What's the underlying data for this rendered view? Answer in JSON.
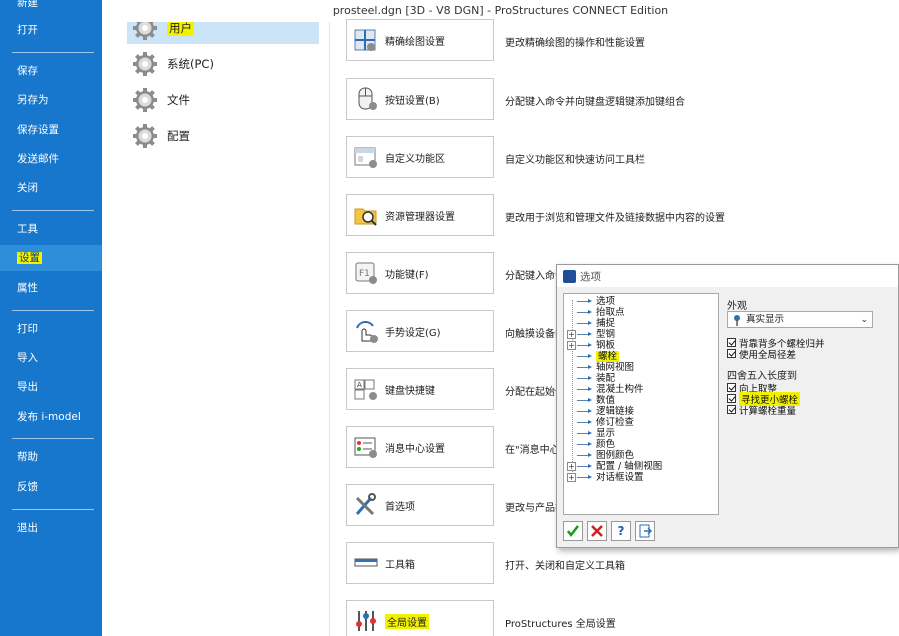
{
  "window": {
    "title": "prosteel.dgn [3D - V8 DGN] - ProStructures CONNECT Edition"
  },
  "nav": {
    "items": [
      {
        "id": "new",
        "label": "新建"
      },
      {
        "id": "open",
        "label": "打开"
      },
      {
        "id": "save",
        "label": "保存"
      },
      {
        "id": "saveas",
        "label": "另存为"
      },
      {
        "id": "savesettings",
        "label": "保存设置"
      },
      {
        "id": "sendmail",
        "label": "发送邮件"
      },
      {
        "id": "close",
        "label": "关闭"
      },
      {
        "id": "tools",
        "label": "工具"
      },
      {
        "id": "settings",
        "label": "设置",
        "active": true
      },
      {
        "id": "properties",
        "label": "属性"
      },
      {
        "id": "print",
        "label": "打印"
      },
      {
        "id": "import",
        "label": "导入"
      },
      {
        "id": "export",
        "label": "导出"
      },
      {
        "id": "publish",
        "label": "发布 i-model"
      },
      {
        "id": "help",
        "label": "帮助"
      },
      {
        "id": "feedback",
        "label": "反馈"
      },
      {
        "id": "exit",
        "label": "退出"
      }
    ],
    "highlight_color": "#f2f200",
    "bg_color": "#1777cc"
  },
  "categories": [
    {
      "label": "用户",
      "selected": true,
      "icon": "gear-icon"
    },
    {
      "label": "系统(PC)",
      "icon": "gear-icon"
    },
    {
      "label": "文件",
      "icon": "gear-icon"
    },
    {
      "label": "配置",
      "icon": "gear-icon"
    }
  ],
  "settings": [
    {
      "label": "精确绘图设置",
      "desc": "更改精确绘图的操作和性能设置",
      "icon": "accudraw-icon"
    },
    {
      "label": "按钮设置(B)",
      "desc": "分配键入命令并向键盘逻辑键添加键组合",
      "icon": "mouse-icon"
    },
    {
      "label": "自定义功能区",
      "desc": "自定义功能区和快速访问工具栏",
      "icon": "ribbon-icon"
    },
    {
      "label": "资源管理器设置",
      "desc": "更改用于浏览和管理文件及链接数据中内容的设置",
      "icon": "explorer-icon"
    },
    {
      "label": "功能键(F)",
      "desc": "分配键入命令",
      "icon": "function-key-icon"
    },
    {
      "label": "手势设定(G)",
      "desc": "向触摸设备的",
      "icon": "gesture-icon"
    },
    {
      "label": "键盘快捷键",
      "desc": "分配在起始位",
      "icon": "keyboard-icon"
    },
    {
      "label": "消息中心设置",
      "desc": "在\"消息中心\"",
      "icon": "message-center-icon"
    },
    {
      "label": "首选项",
      "desc": "更改与产品插",
      "icon": "tools-icon"
    },
    {
      "label": "工具箱",
      "desc": "打开、关闭和自定义工具箱",
      "icon": "toolbox-icon"
    },
    {
      "label": "全局设置",
      "desc": "ProStructures 全局设置",
      "icon": "global-settings-icon"
    }
  ],
  "dialog": {
    "title": "选项",
    "tree": [
      {
        "label": "选项",
        "exp": false
      },
      {
        "label": "抬取点",
        "exp": false
      },
      {
        "label": "捕捉",
        "exp": false
      },
      {
        "label": "型钢",
        "exp": true
      },
      {
        "label": "钢板",
        "exp": true
      },
      {
        "label": "螺栓",
        "exp": false,
        "highlight": true
      },
      {
        "label": "轴网视图",
        "exp": false
      },
      {
        "label": "装配",
        "exp": false
      },
      {
        "label": "混凝土构件",
        "exp": false
      },
      {
        "label": "数值",
        "exp": false
      },
      {
        "label": "逻辑链接",
        "exp": false
      },
      {
        "label": "修订检查",
        "exp": false
      },
      {
        "label": "显示",
        "exp": false
      },
      {
        "label": "颜色",
        "exp": false
      },
      {
        "label": "图例颜色",
        "exp": false
      },
      {
        "label": "配置 / 轴侧视图",
        "exp": true
      },
      {
        "label": "对话框设置",
        "exp": true
      }
    ],
    "appearance_label": "外观",
    "display_combo": "真实显示",
    "checks1": [
      {
        "label": "背靠背多个螺栓归并",
        "checked": true
      },
      {
        "label": "使用全局径差",
        "checked": true
      }
    ],
    "rounding_label": "四舍五入长度到",
    "checks2": [
      {
        "label": "向上取整",
        "checked": true
      },
      {
        "label": "寻找更小螺栓",
        "checked": true,
        "highlight": true
      },
      {
        "label": "计算螺栓重量",
        "checked": true
      }
    ],
    "footer_buttons": [
      "ok-icon",
      "cancel-icon",
      "help-icon",
      "export-icon"
    ]
  }
}
